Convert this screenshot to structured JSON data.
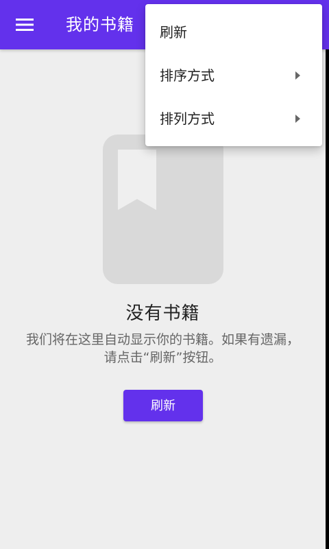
{
  "appbar": {
    "title": "我的书籍",
    "menu_icon": "hamburger-icon",
    "background_color": "#6331ec"
  },
  "empty_state": {
    "illustration_icon": "bookmark-book-icon",
    "title": "没有书籍",
    "description": "我们将在这里自动显示你的书籍。如果有遗漏，请点击“刷新”按钮。",
    "button_label": "刷新"
  },
  "popup_menu": {
    "items": [
      {
        "label": "刷新",
        "has_submenu": false
      },
      {
        "label": "排序方式",
        "has_submenu": true
      },
      {
        "label": "排列方式",
        "has_submenu": true
      }
    ]
  }
}
